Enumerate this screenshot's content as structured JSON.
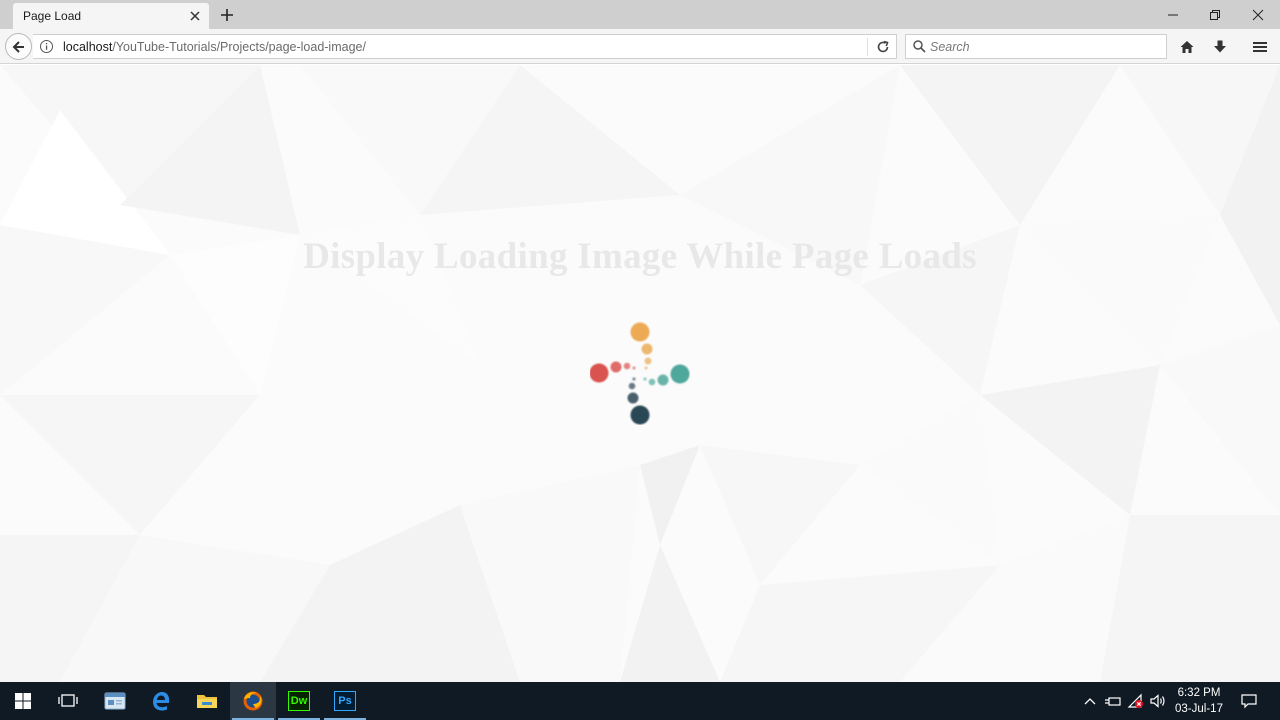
{
  "browser": {
    "tab_title": "Page Load",
    "url_host": "localhost",
    "url_path": "/YouTube-Tutorials/Projects/page-load-image/",
    "search_placeholder": "Search"
  },
  "page": {
    "heading": "Display Loading Image While Page Loads",
    "loader_colors": {
      "orange": "#ecaa55",
      "red": "#d9534f",
      "teal": "#4fa89b",
      "navy": "#2c4654"
    }
  },
  "taskbar": {
    "apps": [
      "start-icon",
      "task-view-icon",
      "file-app-icon",
      "edge-icon",
      "file-explorer-icon",
      "firefox-icon",
      "dreamweaver-icon",
      "photoshop-icon"
    ],
    "dreamweaver_label": "Dw",
    "photoshop_label": "Ps",
    "time": "6:32 PM",
    "date": "03-Jul-17"
  }
}
